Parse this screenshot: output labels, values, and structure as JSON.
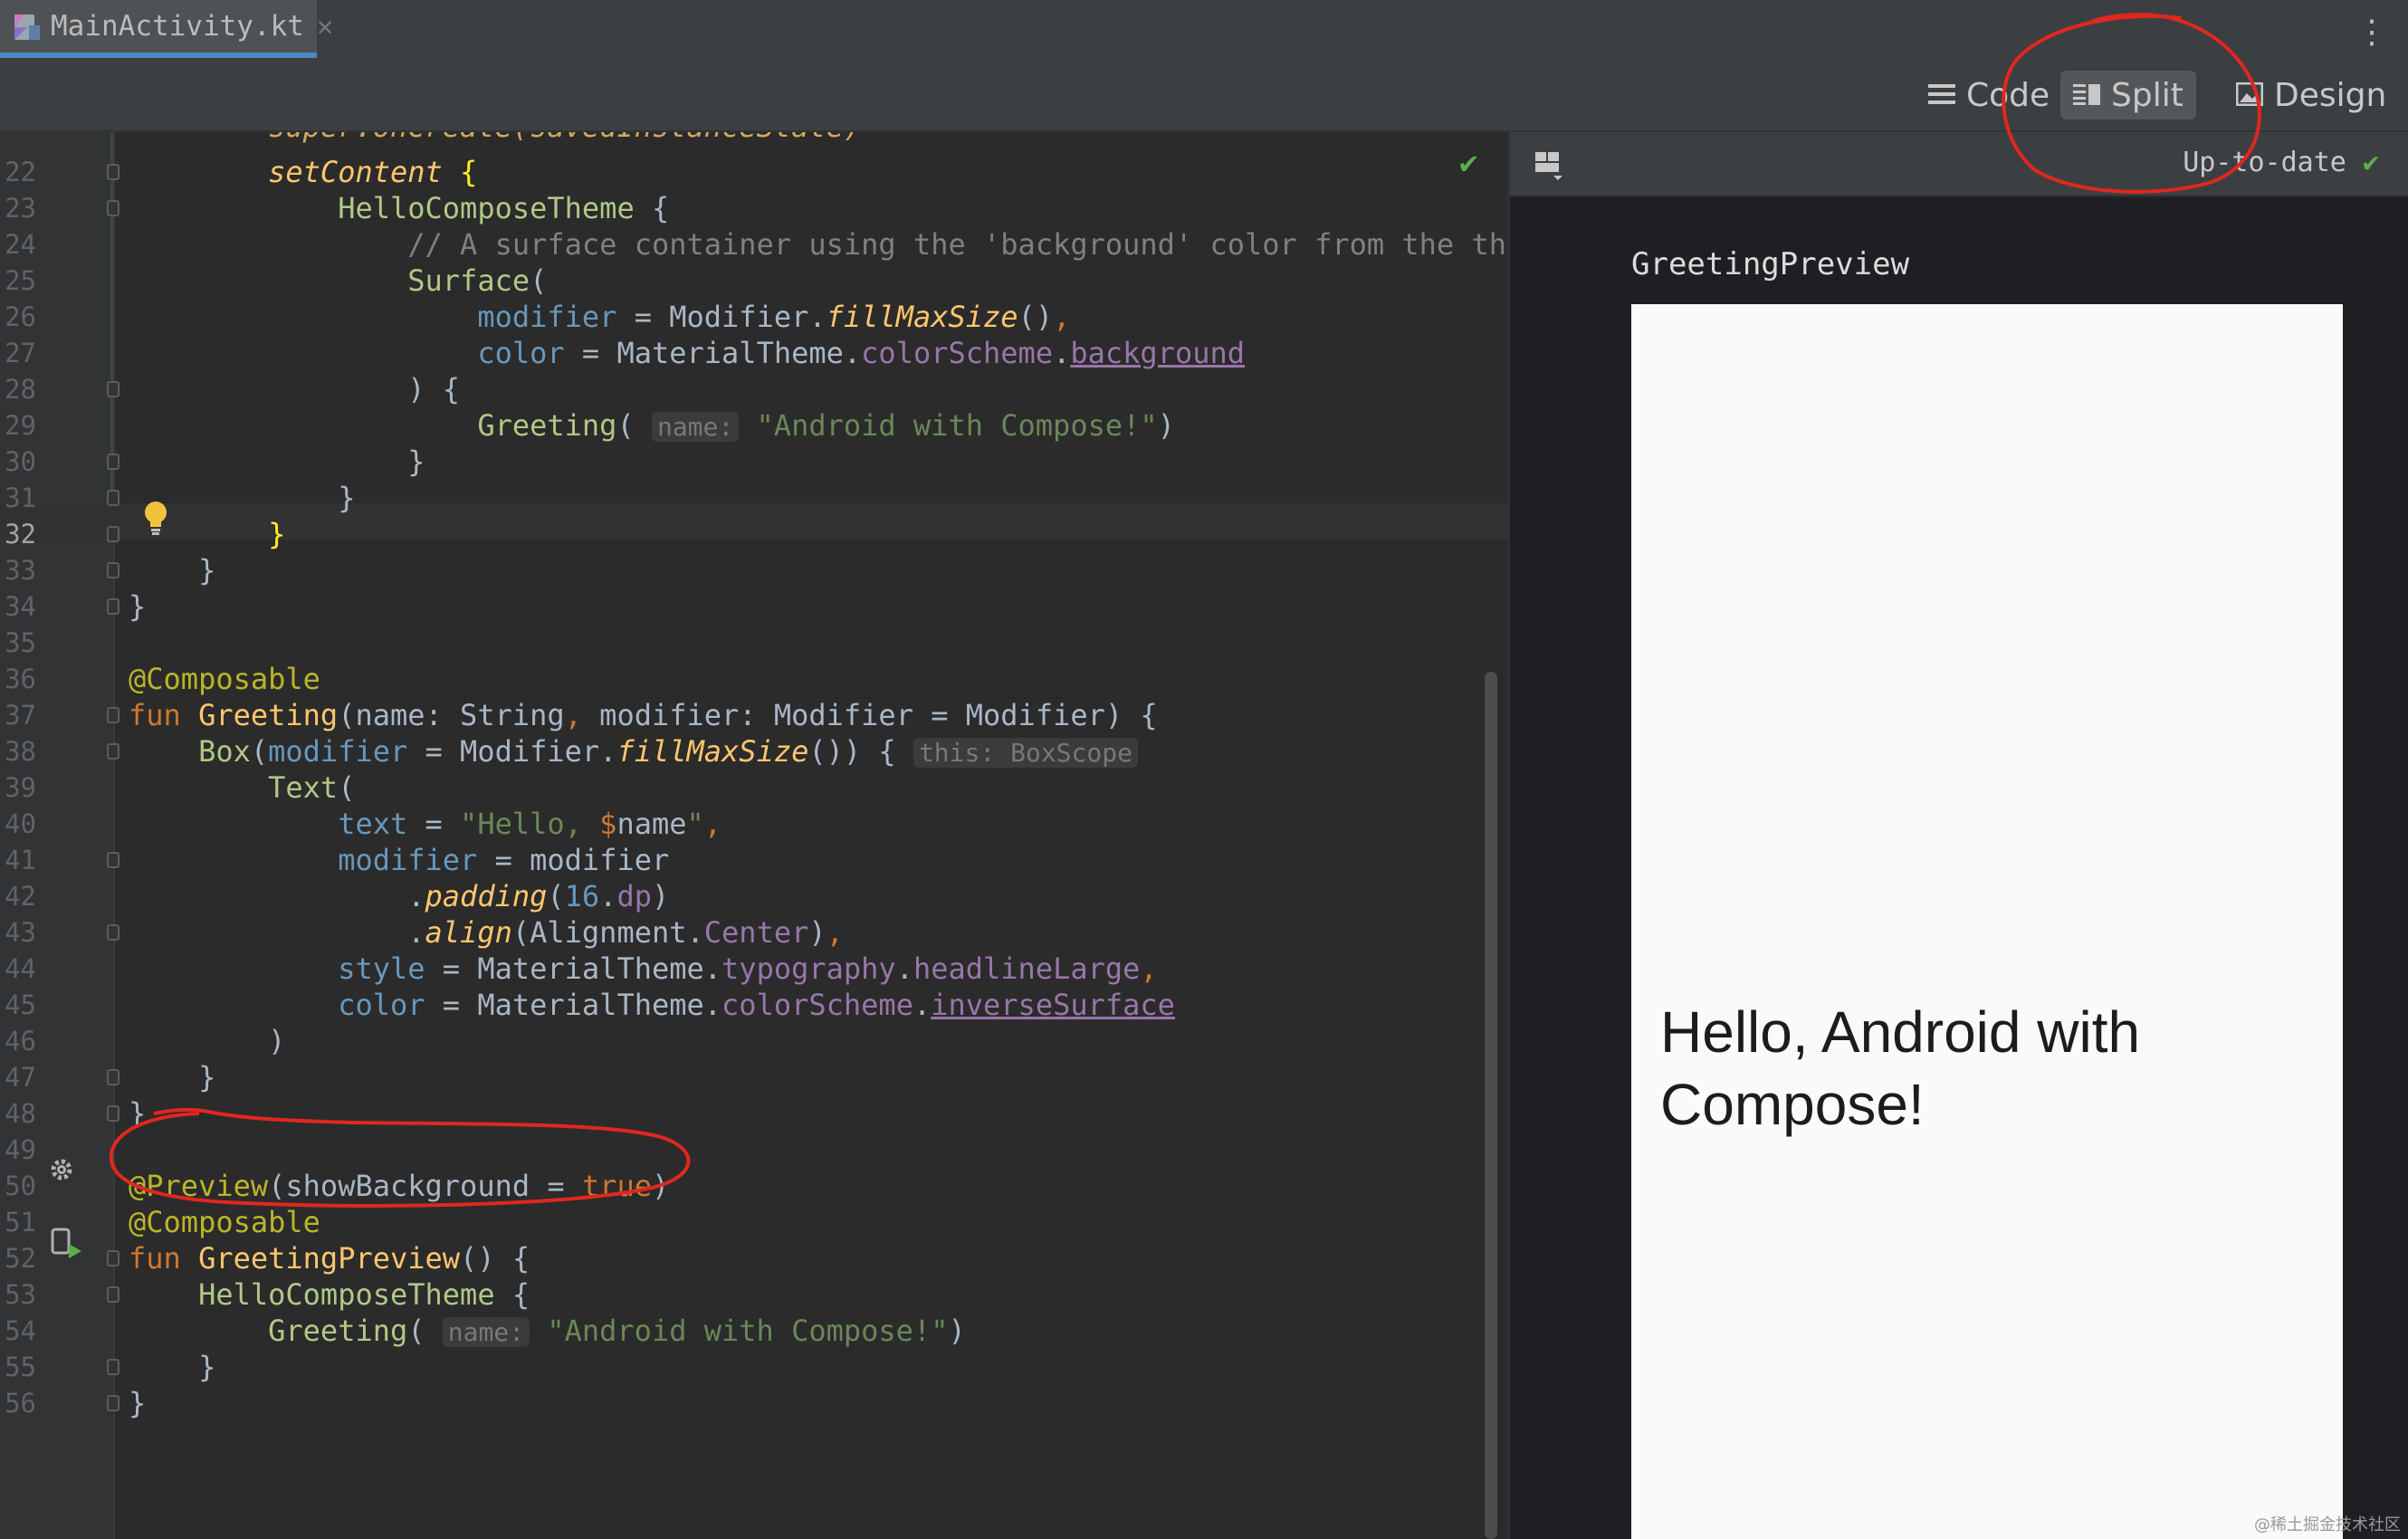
{
  "tab": {
    "filename": "MainActivity.kt",
    "close": "✕"
  },
  "toolbar": {
    "more": "⋮"
  },
  "modes": [
    {
      "label": "Code",
      "active": false
    },
    {
      "label": "Split",
      "active": true
    },
    {
      "label": "Design",
      "active": false
    }
  ],
  "editor": {
    "status_icon": "✔",
    "lines": [
      {
        "n": "22",
        "html": "        <span class=\"ifn\">setContent</span> <span class=\"brk\">{</span>"
      },
      {
        "n": "23",
        "html": "            <span class=\"comp\">HelloComposeTheme</span> {"
      },
      {
        "n": "24",
        "html": "                <span class=\"cm\">// A surface container using the 'background' color from the theme</span>"
      },
      {
        "n": "25",
        "html": "                <span class=\"comp\">Surface</span>("
      },
      {
        "n": "26",
        "html": "                    <span class=\"pm\">modifier</span> = Modifier.<span class=\"ifn\">fillMaxSize</span>()<span class=\"kw\">,</span>"
      },
      {
        "n": "27",
        "html": "                    <span class=\"pm\">color</span> = MaterialTheme.<span class=\"prop\">colorScheme</span>.<span class=\"propu\">background</span>"
      },
      {
        "n": "28",
        "html": "                ) {"
      },
      {
        "n": "29",
        "html": "                    <span class=\"comp\">Greeting</span>( <span class=\"hint\">name:</span> <span class=\"str\">\"Android with Compose!\"</span>)"
      },
      {
        "n": "30",
        "html": "                }"
      },
      {
        "n": "31",
        "html": "            }"
      },
      {
        "n": "32",
        "html": "        <span class=\"brk\">}</span>"
      },
      {
        "n": "33",
        "html": "    }"
      },
      {
        "n": "34",
        "html": "}"
      },
      {
        "n": "35",
        "html": ""
      },
      {
        "n": "36",
        "html": "<span class=\"ann\">@Composable</span>"
      },
      {
        "n": "37",
        "html": "<span class=\"kw\">fun</span> <span class=\"fn\">Greeting</span>(name: String<span class=\"kw\">,</span> modifier: Modifier = Modifier) {"
      },
      {
        "n": "38",
        "html": "    <span class=\"comp\">Box</span>(<span class=\"pm\">modifier</span> = Modifier.<span class=\"ifn\">fillMaxSize</span>()) { <span class=\"hint\">this: BoxScope</span>"
      },
      {
        "n": "39",
        "html": "        <span class=\"comp\">Text</span>("
      },
      {
        "n": "40",
        "html": "            <span class=\"pm\">text</span> = <span class=\"str\">\"Hello, </span><span class=\"kw\">$</span>name<span class=\"str\">\"</span><span class=\"kw\">,</span>"
      },
      {
        "n": "41",
        "html": "            <span class=\"pm\">modifier</span> = modifier"
      },
      {
        "n": "42",
        "html": "                .<span class=\"ifn\">padding</span>(<span class=\"num\">16</span>.<span class=\"prop\">dp</span>)"
      },
      {
        "n": "43",
        "html": "                .<span class=\"ifn\">align</span>(Alignment.<span class=\"prop\">Center</span>)<span class=\"kw\">,</span>"
      },
      {
        "n": "44",
        "html": "            <span class=\"pm\">style</span> = MaterialTheme.<span class=\"prop\">typography</span>.<span class=\"prop\">headlineLarge</span><span class=\"kw\">,</span>"
      },
      {
        "n": "45",
        "html": "            <span class=\"pm\">color</span> = MaterialTheme.<span class=\"prop\">colorScheme</span>.<span class=\"propu\">inverseSurface</span>"
      },
      {
        "n": "46",
        "html": "        )"
      },
      {
        "n": "47",
        "html": "    }"
      },
      {
        "n": "48",
        "html": "}"
      },
      {
        "n": "49",
        "html": ""
      },
      {
        "n": "50",
        "html": "<span class=\"ann\">@Preview</span>(showBackground = <span class=\"kw\">true</span>)"
      },
      {
        "n": "51",
        "html": "<span class=\"ann\">@Composable</span>"
      },
      {
        "n": "52",
        "html": "<span class=\"kw\">fun</span> <span class=\"fn\">GreetingPreview</span>() {"
      },
      {
        "n": "53",
        "html": "    <span class=\"comp\">HelloComposeTheme</span> {"
      },
      {
        "n": "54",
        "html": "        <span class=\"comp\">Greeting</span>( <span class=\"hint\">name:</span> <span class=\"str\">\"Android with Compose!\"</span>)"
      },
      {
        "n": "55",
        "html": "    }"
      },
      {
        "n": "56",
        "html": "}"
      }
    ],
    "current_line": "32"
  },
  "preview": {
    "status": "Up-to-date",
    "status_icon": "✔",
    "title": "GreetingPreview",
    "text": "Hello, Android with Compose!"
  },
  "watermark": "@稀土掘金技术社区",
  "colors": {
    "accent_tab": "#4a88c7",
    "annotation": "#e0271f",
    "ok": "#5bae50"
  }
}
